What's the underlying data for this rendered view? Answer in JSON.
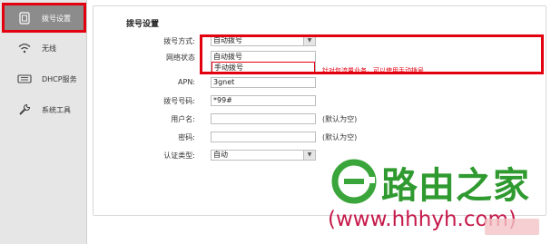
{
  "sidebar": {
    "items": [
      {
        "label": "拨号设置",
        "icon": "sim-card-icon",
        "active": true
      },
      {
        "label": "无线",
        "icon": "wifi-icon",
        "active": false
      },
      {
        "label": "DHCP服务",
        "icon": "network-card-icon",
        "active": false
      },
      {
        "label": "系统工具",
        "icon": "wrench-icon",
        "active": false
      }
    ]
  },
  "form": {
    "title": "拨号设置",
    "dial_mode": {
      "label": "拨号方式:",
      "value": "自动拨号"
    },
    "network_status": {
      "label": "网络状态"
    },
    "dropdown_options": [
      "自动拨号",
      "手动拨号"
    ],
    "hint_red": "针对包流量业务，可以使用手动拨号",
    "apn": {
      "label": "APN:",
      "value": "3gnet"
    },
    "dial_number": {
      "label": "拨号号码:",
      "value": "*99#"
    },
    "username": {
      "label": "用户名:",
      "value": "",
      "hint": "(默认为空)"
    },
    "password": {
      "label": "密码:",
      "value": "",
      "hint": "(默认为空)"
    },
    "auth_type": {
      "label": "认证类型:",
      "value": "自动"
    }
  },
  "watermark": {
    "brand": "路由之家",
    "url": "(www.hhhyh.com)"
  },
  "colors": {
    "highlight": "#e3000f",
    "brand_green": "#2f9a2f",
    "url_red": "#c51a4a",
    "sidebar_active": "#8c8c8c"
  }
}
